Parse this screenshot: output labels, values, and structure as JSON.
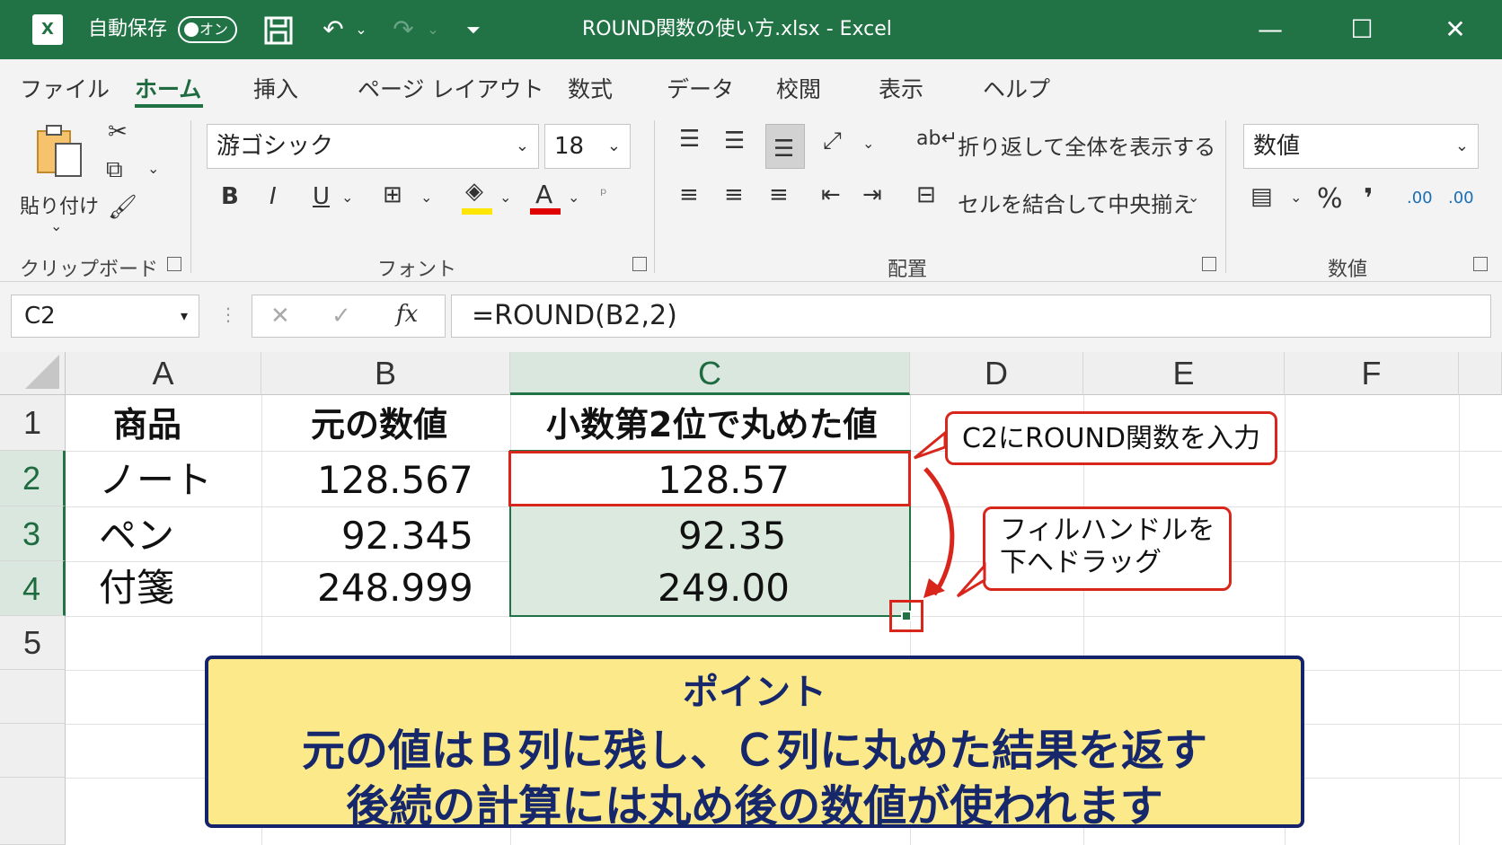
{
  "titlebar": {
    "autosave_label": "自動保存",
    "autosave_state": "オン",
    "title": "ROUND関数の使い方.xlsx - Excel"
  },
  "tabs": [
    "ファイル",
    "ホーム",
    "挿入",
    "ページ レイアウト",
    "数式",
    "データ",
    "校閲",
    "表示",
    "ヘルプ"
  ],
  "active_tab": "ホーム",
  "ribbon": {
    "clipboard": {
      "paste_label": "貼り付け",
      "group_label": "クリップボード"
    },
    "font": {
      "font_name": "游ゴシック",
      "font_size": "18",
      "bold": "B",
      "italic": "I",
      "underline": "U",
      "font_color_glyph": "A",
      "group_label": "フォント"
    },
    "alignment": {
      "wrap_text": "折り返して全体を表示する",
      "merge_center": "セルを結合して中央揃え",
      "group_label": "配置"
    },
    "number": {
      "format": "数値",
      "percent": "%",
      "comma": "❜",
      "inc_decimal": ".00",
      "dec_decimal": ".00",
      "group_label": "数値"
    }
  },
  "formula_bar": {
    "name_box": "C2",
    "fx": "fx",
    "formula": "=ROUND(B2,2)"
  },
  "columns": [
    "A",
    "B",
    "C",
    "D",
    "E",
    "F"
  ],
  "selected_column": "C",
  "rows": [
    "1",
    "2",
    "3",
    "4",
    "5"
  ],
  "selected_rows": [
    "2",
    "3",
    "4"
  ],
  "table": {
    "headers": [
      "商品",
      "元の数値",
      "小数第2位で丸めた値"
    ],
    "rows": [
      [
        "ノート",
        "128.567",
        "128.57"
      ],
      [
        "ペン",
        "92.345",
        "92.35"
      ],
      [
        "付箋",
        "248.999",
        "249.00"
      ]
    ]
  },
  "callouts": {
    "c2": "C2にROUND関数を入力",
    "fill_line1": "フィルハンドルを",
    "fill_line2": "下へドラッグ"
  },
  "point_box": {
    "title": "ポイント",
    "line1": "元の値はＢ列に残し、Ｃ列に丸めた結果を返す",
    "line2": "後続の計算には丸め後の数値が使われます"
  },
  "colors": {
    "excel_green": "#217346",
    "highlight_red": "#d9261c",
    "range_fill": "#dbe9df",
    "point_bg": "#fbe98a",
    "point_text": "#16286b"
  }
}
